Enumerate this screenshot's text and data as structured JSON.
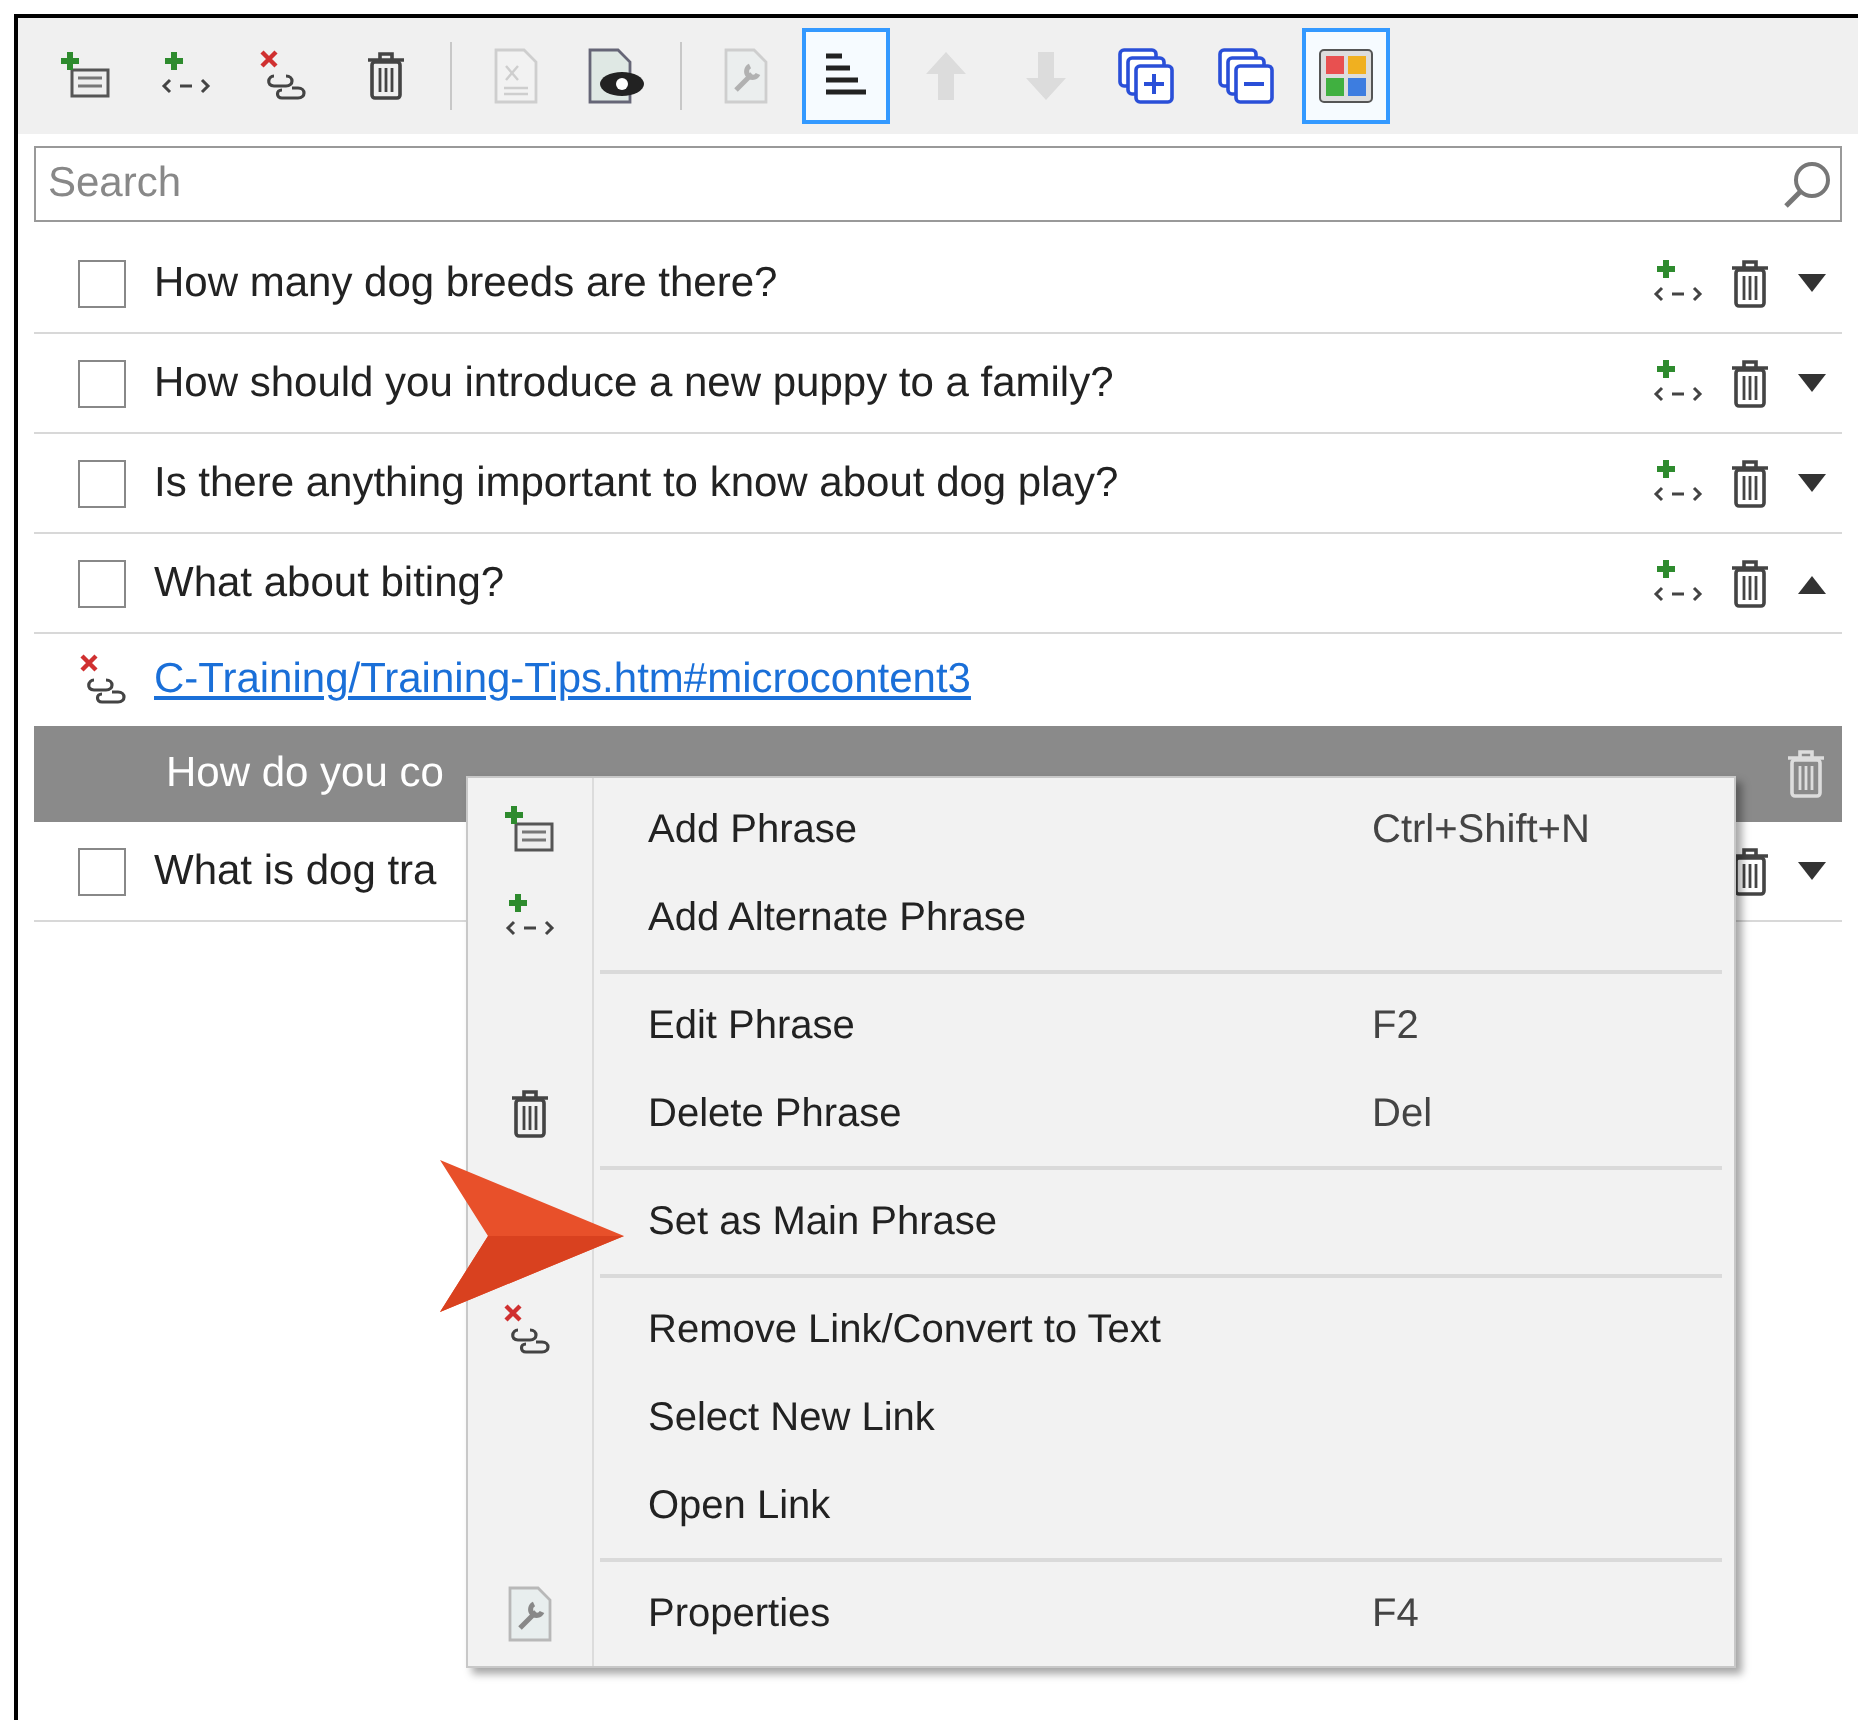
{
  "toolbar": [
    {
      "kind": "add-phrase",
      "disabled": false,
      "selected": false
    },
    {
      "kind": "add-alternate",
      "disabled": false,
      "selected": false
    },
    {
      "kind": "remove-link",
      "disabled": false,
      "selected": false
    },
    {
      "kind": "delete",
      "disabled": false,
      "selected": false
    },
    {
      "kind": "separator"
    },
    {
      "kind": "document",
      "disabled": true,
      "selected": false
    },
    {
      "kind": "preview",
      "disabled": false,
      "selected": false
    },
    {
      "kind": "separator"
    },
    {
      "kind": "properties",
      "disabled": true,
      "selected": false
    },
    {
      "kind": "sort",
      "disabled": false,
      "selected": true
    },
    {
      "kind": "up",
      "disabled": true,
      "selected": false
    },
    {
      "kind": "down",
      "disabled": true,
      "selected": false
    },
    {
      "kind": "expand-all",
      "disabled": false,
      "selected": false
    },
    {
      "kind": "collapse-all",
      "disabled": false,
      "selected": false
    },
    {
      "kind": "colors",
      "disabled": false,
      "selected": true
    }
  ],
  "search": {
    "placeholder": "Search"
  },
  "rows": [
    {
      "kind": "question",
      "text": "How many dog breeds are there?",
      "checked": false,
      "expanded": false,
      "selected": false
    },
    {
      "kind": "question",
      "text": "How should you introduce a new puppy to a family?",
      "checked": false,
      "expanded": false,
      "selected": false
    },
    {
      "kind": "question",
      "text": "Is there anything important to know about dog play?",
      "checked": false,
      "expanded": false,
      "selected": false
    },
    {
      "kind": "question",
      "text": "What about biting?",
      "checked": false,
      "expanded": true,
      "selected": false
    },
    {
      "kind": "link",
      "text": "C-Training/Training-Tips.htm#microcontent3",
      "selected": false
    },
    {
      "kind": "phrase",
      "text": "How do you co",
      "selected": true
    },
    {
      "kind": "question",
      "text": "What is dog tra",
      "checked": false,
      "expanded": false,
      "selected": false
    }
  ],
  "context_menu": {
    "groups": [
      [
        {
          "kind": "add-phrase",
          "label": "Add Phrase",
          "shortcut": "Ctrl+Shift+N"
        },
        {
          "kind": "add-alternate",
          "label": "Add Alternate Phrase"
        }
      ],
      [
        {
          "kind": "plain",
          "label": "Edit Phrase",
          "shortcut": "F2"
        },
        {
          "kind": "delete",
          "label": "Delete Phrase",
          "shortcut": "Del"
        }
      ],
      [
        {
          "kind": "plain",
          "label": "Set as Main Phrase"
        }
      ],
      [
        {
          "kind": "remove-link",
          "label": "Remove Link/Convert to Text"
        },
        {
          "kind": "plain",
          "label": "Select New Link"
        },
        {
          "kind": "plain",
          "label": "Open Link"
        }
      ],
      [
        {
          "kind": "properties",
          "label": "Properties",
          "shortcut": "F4"
        }
      ]
    ]
  }
}
